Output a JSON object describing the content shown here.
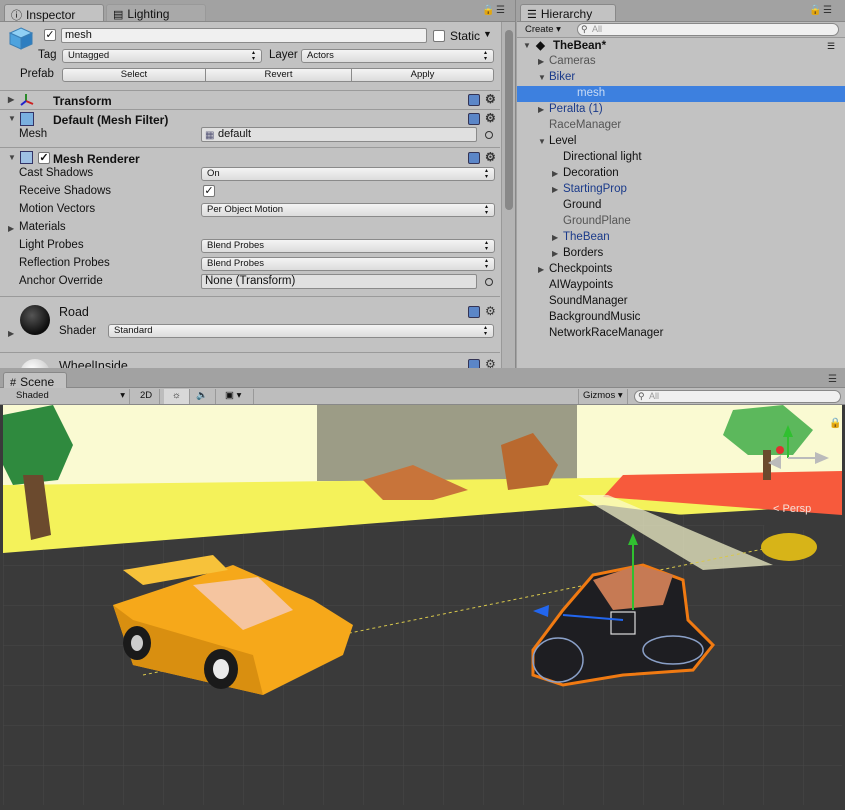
{
  "inspector": {
    "tab_label": "Inspector",
    "lighting_tab_label": "Lighting",
    "object": {
      "name": "mesh",
      "static_label": "Static",
      "tag_label": "Tag",
      "tag_value": "Untagged",
      "layer_label": "Layer",
      "layer_value": "Actors",
      "prefab_label": "Prefab",
      "select_label": "Select",
      "revert_label": "Revert",
      "apply_label": "Apply"
    },
    "transform": {
      "title": "Transform"
    },
    "mesh_filter": {
      "title": "Default (Mesh Filter)",
      "mesh_label": "Mesh",
      "mesh_value": "default"
    },
    "mesh_renderer": {
      "title": "Mesh Renderer",
      "cast_shadows_label": "Cast Shadows",
      "cast_shadows_value": "On",
      "receive_shadows_label": "Receive Shadows",
      "receive_shadows_checked": true,
      "motion_vectors_label": "Motion Vectors",
      "motion_vectors_value": "Per Object Motion",
      "materials_label": "Materials",
      "light_probes_label": "Light Probes",
      "light_probes_value": "Blend Probes",
      "reflection_probes_label": "Reflection Probes",
      "reflection_probes_value": "Blend Probes",
      "anchor_override_label": "Anchor Override",
      "anchor_override_value": "None (Transform)"
    },
    "material_road": {
      "name": "Road",
      "shader_label": "Shader",
      "shader_value": "Standard"
    },
    "material_wheel": {
      "name": "WheelInside"
    }
  },
  "hierarchy": {
    "tab_label": "Hierarchy",
    "create_label": "Create",
    "search_placeholder": "All",
    "scene_name": "TheBean*",
    "items": [
      {
        "label": "Cameras",
        "style": "disabled",
        "indent": 1,
        "arrow": "right"
      },
      {
        "label": "Biker",
        "style": "prefab",
        "indent": 1,
        "arrow": "down"
      },
      {
        "label": "mesh",
        "style": "sel",
        "indent": 2,
        "arrow": ""
      },
      {
        "label": "Peralta (1)",
        "style": "prefab",
        "indent": 1,
        "arrow": "right"
      },
      {
        "label": "RaceManager",
        "style": "disabled",
        "indent": 1,
        "arrow": ""
      },
      {
        "label": "Level",
        "style": "normal",
        "indent": 1,
        "arrow": "down"
      },
      {
        "label": "Directional light",
        "style": "normal",
        "indent": 2,
        "arrow": ""
      },
      {
        "label": "Decoration",
        "style": "normal",
        "indent": 2,
        "arrow": "right"
      },
      {
        "label": "StartingProp",
        "style": "prefab",
        "indent": 2,
        "arrow": "right"
      },
      {
        "label": "Ground",
        "style": "normal",
        "indent": 2,
        "arrow": ""
      },
      {
        "label": "GroundPlane",
        "style": "disabled",
        "indent": 2,
        "arrow": ""
      },
      {
        "label": "TheBean",
        "style": "prefab",
        "indent": 2,
        "arrow": "right"
      },
      {
        "label": "Borders",
        "style": "normal",
        "indent": 2,
        "arrow": "right"
      },
      {
        "label": "Checkpoints",
        "style": "normal",
        "indent": 1,
        "arrow": "right"
      },
      {
        "label": "AIWaypoints",
        "style": "normal",
        "indent": 1,
        "arrow": ""
      },
      {
        "label": "SoundManager",
        "style": "normal",
        "indent": 1,
        "arrow": ""
      },
      {
        "label": "BackgroundMusic",
        "style": "normal",
        "indent": 1,
        "arrow": ""
      },
      {
        "label": "NetworkRaceManager",
        "style": "normal",
        "indent": 1,
        "arrow": ""
      }
    ]
  },
  "scene": {
    "tab_label": "Scene",
    "shading_mode": "Shaded",
    "mode_2d": "2D",
    "gizmos_label": "Gizmos",
    "search_placeholder": "All",
    "persp_label": "Persp"
  },
  "colors": {
    "selection": "#3d80df",
    "prefab_text": "#1a3a8a",
    "ground_yellow": "#f4f25a",
    "road_dark": "#3a3a3a",
    "car_orange": "#f6a81a",
    "selection_outline": "#f07a12"
  }
}
